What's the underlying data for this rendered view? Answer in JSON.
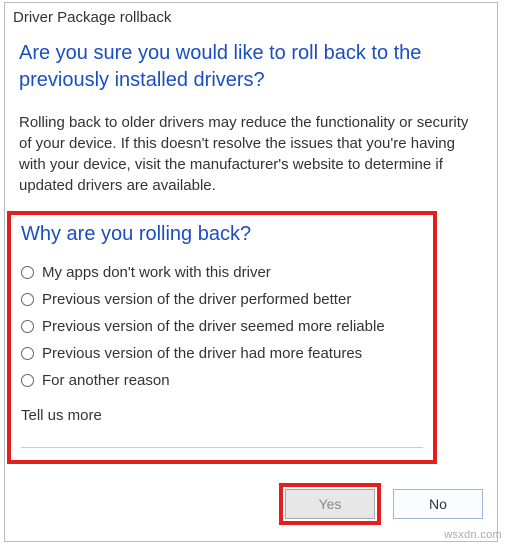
{
  "window": {
    "title": "Driver Package rollback"
  },
  "heading": "Are you sure you would like to roll back to the previously installed drivers?",
  "description": "Rolling back to older drivers may reduce the functionality or security of your device. If this doesn't resolve the issues that you're having with your device, visit the manufacturer's website to determine if updated drivers are available.",
  "subheading": "Why are you rolling back?",
  "reasons": [
    "My apps don't work with this driver",
    "Previous version of the driver performed better",
    "Previous version of the driver seemed more reliable",
    "Previous version of the driver had more features",
    "For another reason"
  ],
  "tell_us_label": "Tell us more",
  "tell_us_value": "",
  "buttons": {
    "yes": "Yes",
    "no": "No"
  },
  "watermark": "wsxdn.com"
}
